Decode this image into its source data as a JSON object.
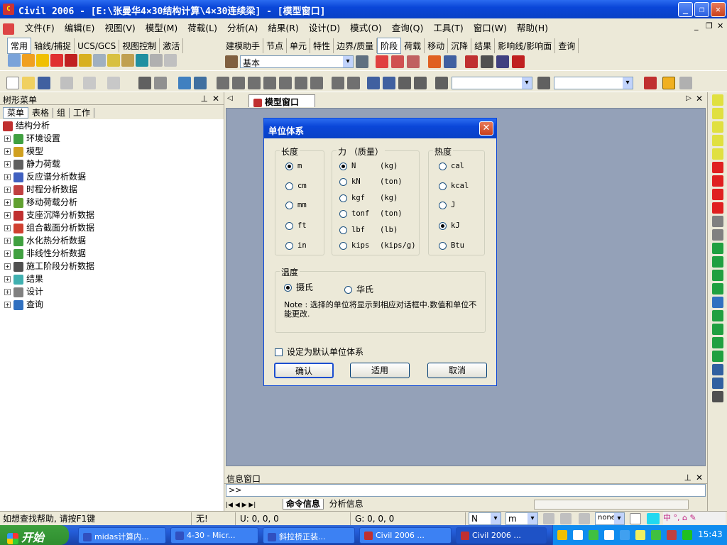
{
  "window": {
    "title": "Civil 2006 - [E:\\张曼华4×30结构计算\\4×30连续梁] - [模型窗口]"
  },
  "menu": [
    "文件(F)",
    "编辑(E)",
    "视图(V)",
    "模型(M)",
    "荷载(L)",
    "分析(A)",
    "结果(R)",
    "设计(D)",
    "模式(O)",
    "查询(Q)",
    "工具(T)",
    "窗口(W)",
    "帮助(H)"
  ],
  "toolbar_tabs_left": [
    "常用",
    "轴线/捕捉",
    "UCS/GCS",
    "视图控制",
    "激活"
  ],
  "toolbar_tabs_right": [
    "建模助手",
    "节点",
    "单元",
    "特性",
    "边界/质量",
    "阶段",
    "荷载",
    "移动",
    "沉降",
    "结果",
    "影响线/影响面",
    "查询"
  ],
  "toolbar_combo": {
    "value": "基本"
  },
  "left_panel": {
    "title": "树形菜单",
    "tabs": [
      "菜单",
      "表格",
      "组",
      "工作"
    ],
    "root": "结构分析",
    "items": [
      "环境设置",
      "模型",
      "静力荷载",
      "反应谱分析数据",
      "时程分析数据",
      "移动荷载分析",
      "支座沉降分析数据",
      "组合截面分析数据",
      "水化热分析数据",
      "非线性分析数据",
      "施工阶段分析数据",
      "结果",
      "设计",
      "查询"
    ]
  },
  "doc_tab": "模型窗口",
  "dialog": {
    "title": "单位体系",
    "length": {
      "label": "长度",
      "options": [
        "m",
        "cm",
        "mm",
        "ft",
        "in"
      ],
      "selected": 0
    },
    "force": {
      "label": "力 （质量）",
      "options": [
        [
          "N",
          "(kg)"
        ],
        [
          "kN",
          "(ton)"
        ],
        [
          "kgf",
          "(kg)"
        ],
        [
          "tonf",
          "(ton)"
        ],
        [
          "lbf",
          "(lb)"
        ],
        [
          "kips",
          "(kips/g)"
        ]
      ],
      "selected": 0
    },
    "heat": {
      "label": "热度",
      "options": [
        "cal",
        "kcal",
        "J",
        "kJ",
        "Btu"
      ],
      "selected": 3
    },
    "temperature": {
      "label": "温度",
      "options": [
        "摄氏",
        "华氏"
      ],
      "selected": 0
    },
    "note": "Note : 选择的单位将显示到相应对话框中.数值和单位不能更改.",
    "default_check": "设定为默认单位体系",
    "ok": "确认",
    "apply": "适用",
    "cancel": "取消"
  },
  "info_panel": {
    "title": "信息窗口",
    "prompt": ">>",
    "tabs": [
      "命令信息",
      "分析信息"
    ]
  },
  "status": {
    "help": "如想查找帮助, 请按F1键",
    "none": "无!",
    "u": "U: 0, 0, 0",
    "g": "G: 0, 0, 0",
    "force_unit": "N",
    "length_unit": "m",
    "combo": "none"
  },
  "taskbar": {
    "start": "开始",
    "tasks": [
      "midas计算内...",
      "4-30 - Micr...",
      "斜拉桥正装...",
      "Civil 2006 ...",
      "Civil 2006 ..."
    ],
    "clock": "15:43"
  }
}
